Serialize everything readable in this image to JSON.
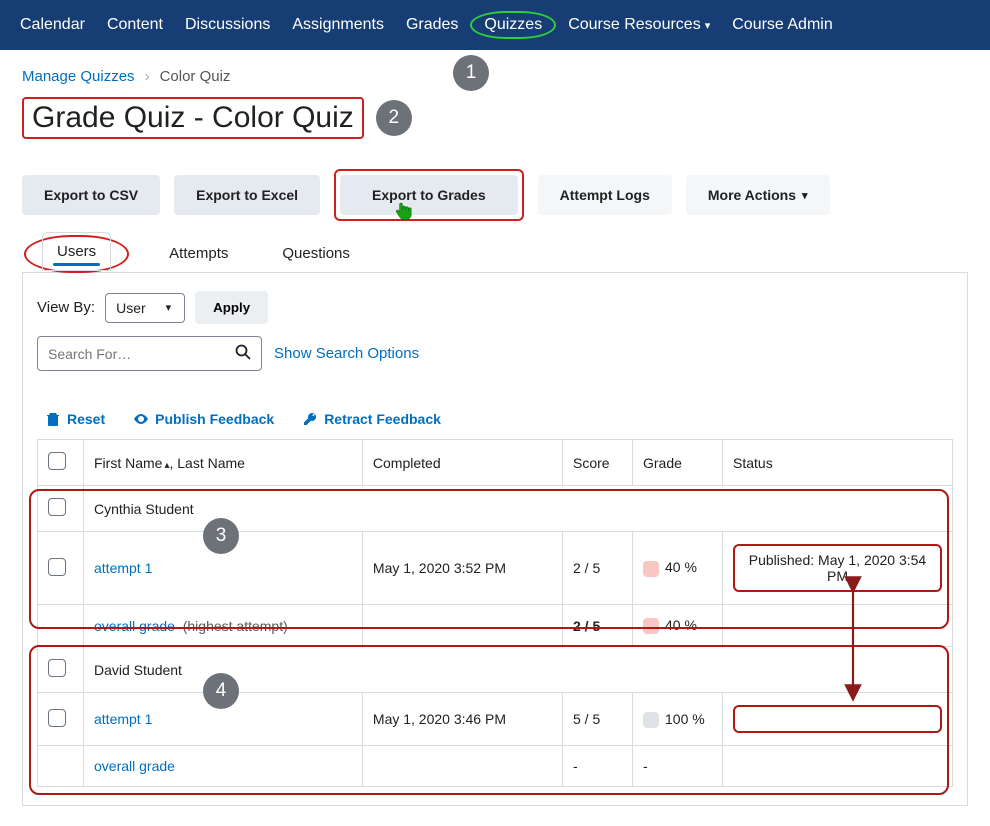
{
  "nav": {
    "items": [
      "Calendar",
      "Content",
      "Discussions",
      "Assignments",
      "Grades",
      "Quizzes",
      "Course Resources",
      "Course Admin"
    ]
  },
  "breadcrumb": {
    "manage": "Manage Quizzes",
    "current": "Color Quiz"
  },
  "heading": "Grade Quiz - Color Quiz",
  "actions": {
    "export_csv": "Export to CSV",
    "export_excel": "Export to Excel",
    "export_grades": "Export to Grades",
    "attempt_logs": "Attempt Logs",
    "more": "More Actions"
  },
  "tabs": {
    "users": "Users",
    "attempts": "Attempts",
    "questions": "Questions"
  },
  "viewby": {
    "label": "View By:",
    "value": "User",
    "apply": "Apply"
  },
  "search": {
    "placeholder": "Search For…",
    "show_options": "Show Search Options"
  },
  "feedback": {
    "reset": "Reset",
    "publish": "Publish Feedback",
    "retract": "Retract Feedback"
  },
  "table": {
    "headers": {
      "name": "First Name",
      "name_sep": ", Last Name",
      "completed": "Completed",
      "score": "Score",
      "grade": "Grade",
      "status": "Status"
    }
  },
  "students": [
    {
      "name": "Cynthia Student",
      "attempts": [
        {
          "label": "attempt 1",
          "completed": "May 1, 2020 3:52 PM",
          "score": "2 / 5",
          "grade": "40 %",
          "grade_color": "red",
          "status": "Published: May 1, 2020 3:54 PM"
        }
      ],
      "overall": {
        "label": "overall grade",
        "note": "(highest attempt)",
        "score": "2 / 5",
        "grade": "40 %",
        "grade_color": "red"
      }
    },
    {
      "name": "David Student",
      "attempts": [
        {
          "label": "attempt 1",
          "completed": "May 1, 2020 3:46 PM",
          "score": "5 / 5",
          "grade": "100 %",
          "grade_color": "gray",
          "status": ""
        }
      ],
      "overall": {
        "label": "overall grade",
        "note": "",
        "score": "-",
        "grade": "-",
        "grade_color": ""
      }
    }
  ],
  "steps": {
    "one": "1",
    "two": "2",
    "three": "3",
    "four": "4"
  }
}
